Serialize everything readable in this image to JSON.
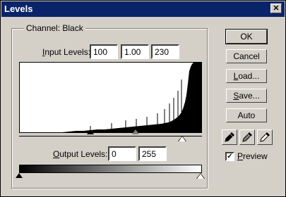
{
  "window": {
    "title": "Levels",
    "close_glyph": "✕"
  },
  "channel": {
    "label": "Channel:",
    "value": "Black"
  },
  "input_levels": {
    "label_prefix": "I",
    "label_rest": "nput Levels:",
    "black": "100",
    "gamma": "1.00",
    "white": "230"
  },
  "output_levels": {
    "label_prefix": "O",
    "label_rest": "utput Levels:",
    "black": "0",
    "white": "255"
  },
  "buttons": {
    "ok": "OK",
    "cancel": "Cancel",
    "load_prefix": "L",
    "load_rest": "oad...",
    "save_prefix": "S",
    "save_rest": "ave...",
    "auto": "Auto"
  },
  "eyedroppers": [
    "black-eyedropper-icon",
    "gray-eyedropper-icon",
    "white-eyedropper-icon"
  ],
  "preview": {
    "prefix": "P",
    "rest": "review",
    "checked": true,
    "check_glyph": "✓"
  },
  "colors": {
    "titlebar": "#0a246a",
    "face": "#d4d0c8"
  }
}
